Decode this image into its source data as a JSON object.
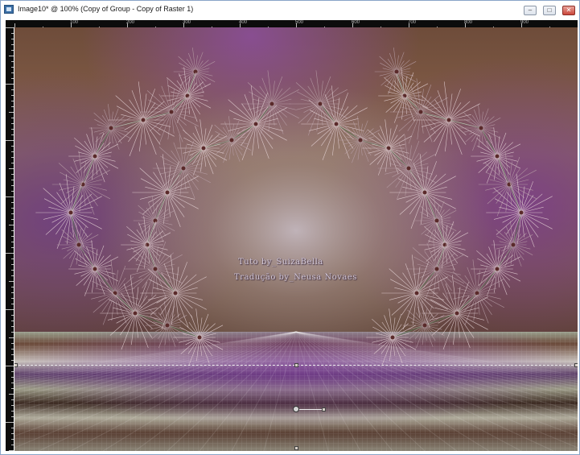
{
  "window": {
    "title": "Image10* @ 100% (Copy of Group - Copy of Raster 1)",
    "buttons": {
      "minimize": "–",
      "maximize": "□",
      "close": "✕"
    }
  },
  "ruler": {
    "top_labels": [
      "100",
      "200",
      "300",
      "400",
      "500",
      "600",
      "700",
      "800",
      "900"
    ]
  },
  "canvas": {
    "watermark_line1": "Tuto by_SuizaBella",
    "watermark_line2": "Tradução by_Neusa Novaes"
  },
  "colors": {
    "accent_purple": "#7b3c8c",
    "bronze": "#7a5238",
    "sage": "#8d9a86"
  }
}
